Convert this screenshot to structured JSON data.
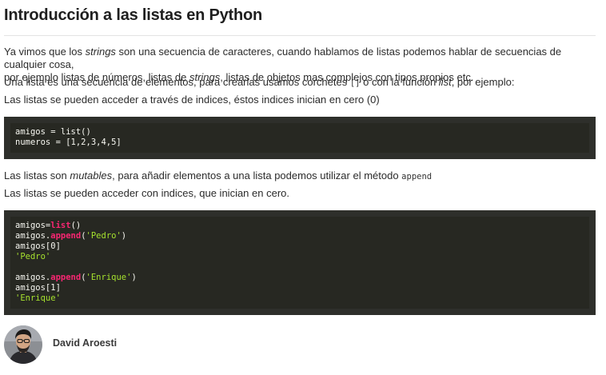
{
  "article": {
    "title": "Introducción a las listas en Python",
    "intro": {
      "line1_a": "Ya vimos que los ",
      "line1_em": "strings",
      "line1_b": " son una secuencia de caracteres, cuando hablamos de listas podemos hablar de secuencias de cualquier cosa,",
      "line2_a": "por ejemplo listas de números, listas de ",
      "line2_em": "strings",
      "line2_b": ", listas de objetos mas complejos con tipos propios etc."
    },
    "para2": {
      "a": "Una lista es una secuencia de elementos, para crearlas usamos corchetes ",
      "code": "[]",
      "b": " o con la función ",
      "em": "list",
      "c": ", por ejemplo:"
    },
    "para3": "Las listas se pueden acceder a través de indices, éstos indices inician en cero (0)",
    "code1": {
      "line1": "amigos = list()",
      "line2": "numeros = [1,2,3,4,5]"
    },
    "para4": {
      "a": "Las listas son ",
      "em": "mutables",
      "b": ", para añadir elementos a una lista podemos utilizar el método ",
      "code": "append"
    },
    "para5": "Las listas se pueden acceder con indices, que inician en cero.",
    "code2": {
      "l1_var": "amigos=",
      "l1_fn": "list",
      "l1_end": "()",
      "l2_var": "amigos.",
      "l2_fn": "append",
      "l2_open": "(",
      "l2_str": "'Pedro'",
      "l2_close": ")",
      "l3": "amigos[0]",
      "l4_str": "'Pedro'",
      "l6_var": "amigos.",
      "l6_fn": "append",
      "l6_open": "(",
      "l6_str": "'Enrique'",
      "l6_close": ")",
      "l7": "amigos[1]",
      "l8_str": "'Enrique'"
    }
  },
  "author": {
    "name": "David Aroesti"
  },
  "colors": {
    "code_background": "#272822",
    "code_keyword": "#f92672",
    "code_string": "#a6e22e",
    "code_text": "#f8f8f2"
  }
}
